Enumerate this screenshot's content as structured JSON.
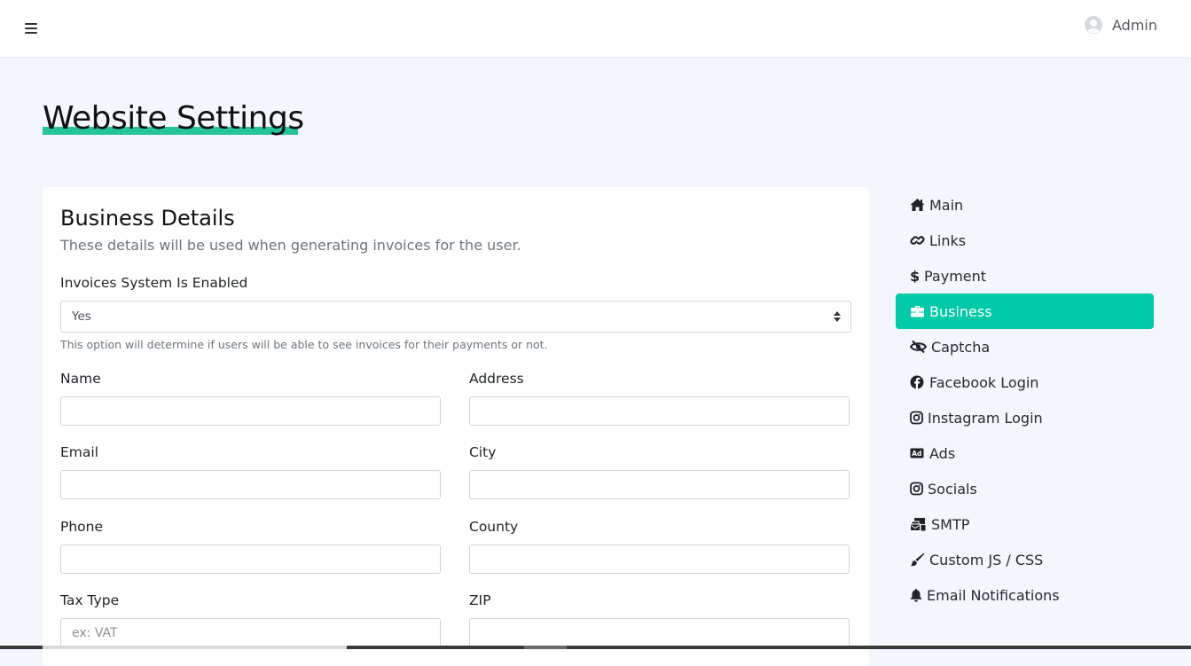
{
  "header": {
    "menu_icon": "hamburger-icon",
    "user_icon": "user-avatar-icon",
    "user_name": "Admin"
  },
  "page": {
    "title": "Website Settings",
    "accent_color": "#25c49a"
  },
  "card": {
    "title": "Business Details",
    "description": "These details will be used when generating invoices for the user.",
    "invoices_label": "Invoices System Is Enabled",
    "invoices_value": "Yes",
    "invoices_help": "This option will determine if users will be able to see invoices for their payments or not.",
    "fields": {
      "name_label": "Name",
      "name_value": "",
      "address_label": "Address",
      "address_value": "",
      "email_label": "Email",
      "email_value": "",
      "city_label": "City",
      "city_value": "",
      "phone_label": "Phone",
      "phone_value": "",
      "county_label": "County",
      "county_value": "",
      "tax_type_label": "Tax Type",
      "tax_type_placeholder": "ex: VAT",
      "tax_type_value": "",
      "zip_label": "ZIP",
      "zip_value": ""
    }
  },
  "sidebar": {
    "active_color": "#00c9a7",
    "active_index": 3,
    "items": [
      {
        "label": "Main",
        "icon": "home-icon"
      },
      {
        "label": "Links",
        "icon": "link-icon"
      },
      {
        "label": "Payment",
        "icon": "dollar-icon"
      },
      {
        "label": "Business",
        "icon": "briefcase-icon"
      },
      {
        "label": "Captcha",
        "icon": "eye-slash-icon"
      },
      {
        "label": "Facebook Login",
        "icon": "facebook-icon"
      },
      {
        "label": "Instagram Login",
        "icon": "instagram-icon"
      },
      {
        "label": "Ads",
        "icon": "ad-icon"
      },
      {
        "label": "Socials",
        "icon": "instagram-icon"
      },
      {
        "label": "SMTP",
        "icon": "mail-bulk-icon"
      },
      {
        "label": "Custom JS / CSS",
        "icon": "paint-brush-icon"
      },
      {
        "label": "Email Notifications",
        "icon": "bell-icon"
      }
    ]
  }
}
